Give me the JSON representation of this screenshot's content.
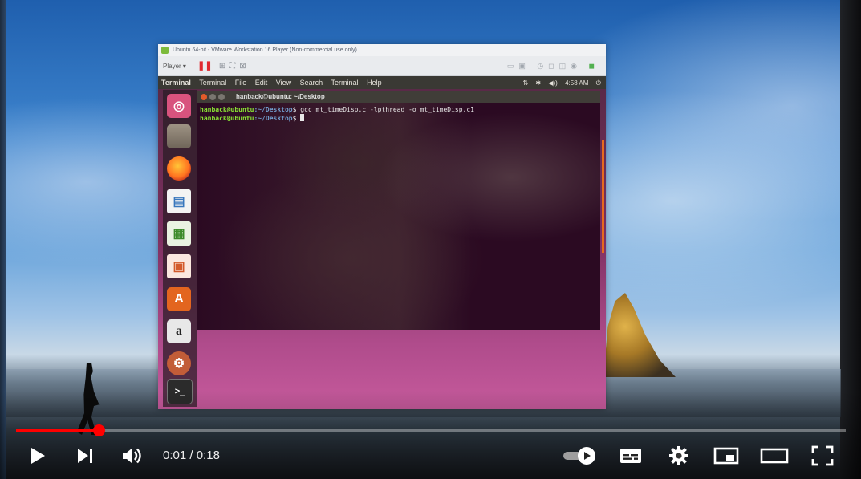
{
  "vm": {
    "window_title": "Ubuntu 64-bit - VMware Workstation 16 Player (Non-commercial use only)",
    "player_menu": "Player ▾"
  },
  "ubuntu": {
    "top_menu": [
      "Terminal",
      "Terminal",
      "File",
      "Edit",
      "View",
      "Search",
      "Terminal",
      "Help"
    ],
    "tray": {
      "network": "⇅",
      "bluetooth": "✱",
      "volume": "◀))",
      "clock": "4:58 AM",
      "power": "⏻"
    }
  },
  "launcher": [
    {
      "icon": "dash-icon",
      "glyph": "◎"
    },
    {
      "icon": "files-icon",
      "glyph": ""
    },
    {
      "icon": "firefox-icon",
      "glyph": ""
    },
    {
      "icon": "writer-icon",
      "glyph": "▤"
    },
    {
      "icon": "calc-icon",
      "glyph": "▦"
    },
    {
      "icon": "impress-icon",
      "glyph": "▣"
    },
    {
      "icon": "software-center-icon",
      "glyph": "A"
    },
    {
      "icon": "amazon-icon",
      "glyph": "a"
    },
    {
      "icon": "settings-icon",
      "glyph": "⚙"
    },
    {
      "icon": "terminal-icon",
      "glyph": ">_"
    }
  ],
  "terminal": {
    "title": "hanback@ubuntu: ~/Desktop",
    "lines": [
      {
        "prompt": "hanback@ubuntu",
        "dir": ":~/Desktop",
        "cmd": "$ gcc mt_timeDisp.c -lpthread -o mt_timeDisp.c1"
      },
      {
        "prompt": "hanback@ubuntu",
        "dir": ":~/Desktop",
        "cmd": "$ "
      }
    ]
  },
  "player": {
    "current_time": "0:01",
    "separator": " / ",
    "duration": "0:18",
    "progress_fraction": 0.1,
    "accent_color": "#ff0000"
  }
}
